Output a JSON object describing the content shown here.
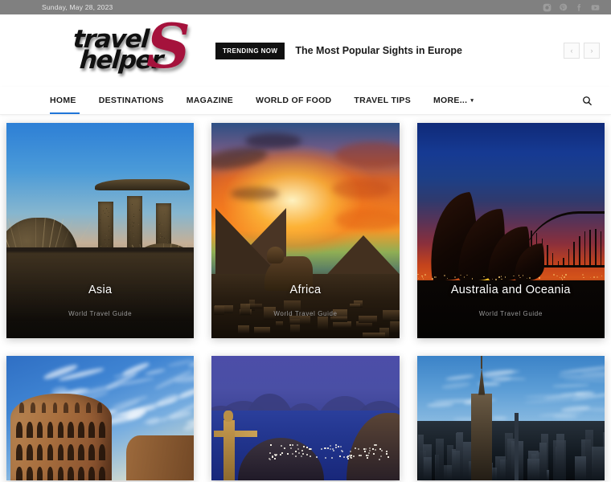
{
  "topbar": {
    "date": "Sunday, May 28, 2023",
    "social": [
      {
        "name": "instagram-icon",
        "label": "Instagram"
      },
      {
        "name": "pinterest-icon",
        "label": "Pinterest"
      },
      {
        "name": "facebook-icon",
        "label": "Facebook"
      },
      {
        "name": "youtube-icon",
        "label": "YouTube"
      }
    ]
  },
  "header": {
    "logo": {
      "line1": "travel",
      "line2": "helper",
      "mark": "S",
      "mark_color": "#a5123c"
    },
    "trending": {
      "badge": "TRENDING NOW",
      "title": "The Most Popular Sights in Europe"
    },
    "slider": {
      "prev": "‹",
      "next": "›"
    }
  },
  "nav": {
    "items": [
      {
        "label": "HOME",
        "active": true
      },
      {
        "label": "DESTINATIONS",
        "active": false
      },
      {
        "label": "MAGAZINE",
        "active": false
      },
      {
        "label": "WORLD OF FOOD",
        "active": false
      },
      {
        "label": "TRAVEL TIPS",
        "active": false
      },
      {
        "label": "MORE...",
        "active": false,
        "caret": "▾"
      }
    ],
    "active_color": "#2075d8",
    "search_icon": "search-icon"
  },
  "cards": [
    {
      "title": "Asia",
      "subtitle": "World Travel Guide",
      "scene": "asia"
    },
    {
      "title": "Africa",
      "subtitle": "World Travel Guide",
      "scene": "africa"
    },
    {
      "title": "Australia and Oceania",
      "subtitle": "World Travel Guide",
      "scene": "aus"
    },
    {
      "title": "",
      "subtitle": "",
      "scene": "eu"
    },
    {
      "title": "",
      "subtitle": "",
      "scene": "rio"
    },
    {
      "title": "",
      "subtitle": "",
      "scene": "ny"
    }
  ]
}
